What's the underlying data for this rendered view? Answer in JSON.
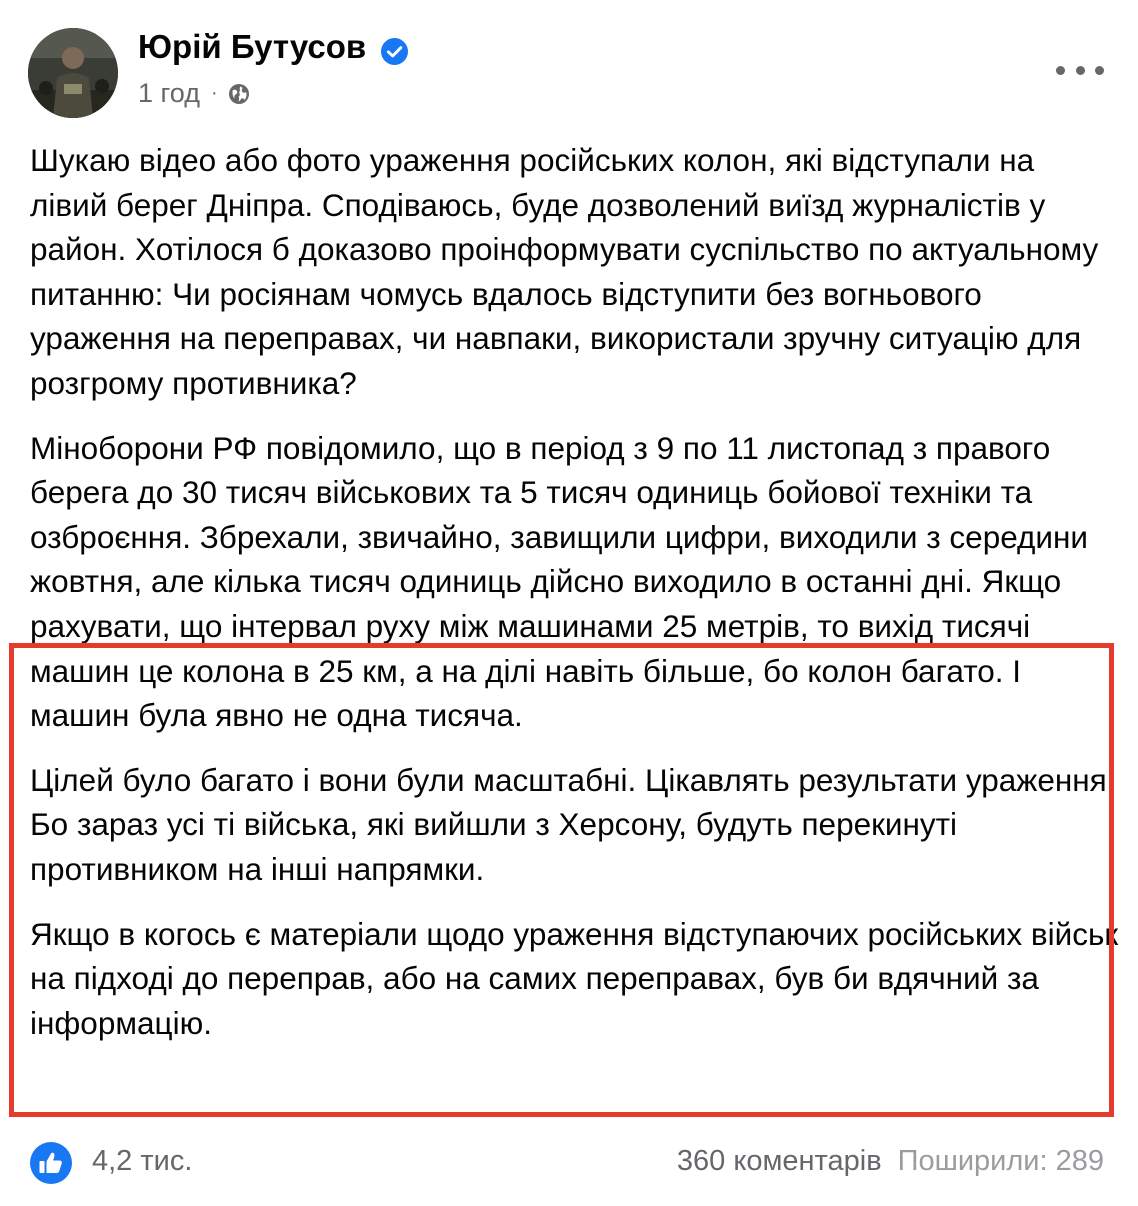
{
  "post": {
    "author": "Юрій Бутусов",
    "time": "1 год",
    "separator": "·",
    "paragraphs": [
      "Шукаю відео або фото ураження російських колон, які відступали на лівий берег Дніпра. Сподіваюсь, буде дозволений виїзд журналістів у район. Хотілося б доказово проінформувати суспільство по актуальному питанню: Чи росіянам чомусь вдалось відступити без вогньового ураження на переправах, чи навпаки, використали зручну ситуацію для розгрому противника?",
      "Міноборони РФ повідомило, що в період з 9 по 11 листопад з правого берега до 30 тисяч військових та 5 тисяч одиниць бойової техніки та озброєння. Збрехали, звичайно, завищили цифри, виходили з середини  жовтня, але кілька тисяч одиниць дійсно виходило в останні дні. Якщо рахувати, що інтервал руху між машинами 25 метрів, то вихід тисячі машин це колона в 25 км, а на ділі навіть більше, бо колон багато. І машин була  явно не одна тисяча.",
      "Цілей було багато і вони були масштабні. Цікавлять результати ураження. Бо зараз усі ті війська, які вийшли з Херсону, будуть перекинуті противником на інші напрямки.",
      "Якщо в когось є матеріали щодо ураження відступаючих російських військ на підході до переправ, або на самих переправах, був би вдячний за інформацію."
    ]
  },
  "footer": {
    "likes": "4,2 тис.",
    "comments": "360 коментарів",
    "shares": "Поширили: 289"
  },
  "icons": {
    "verified": "verified-badge-icon",
    "audience": "globe-icon",
    "more": "more-options-icon",
    "like": "like-reaction-icon"
  },
  "colors": {
    "verified": "#1877f2",
    "like": "#1877f2",
    "secondary_text": "#65676b",
    "highlight_border": "#e43b2c"
  }
}
